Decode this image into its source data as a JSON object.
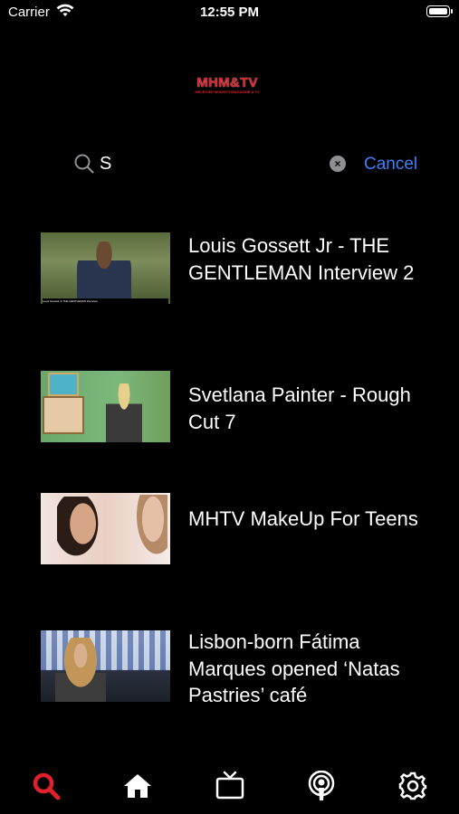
{
  "status_bar": {
    "carrier": "Carrier",
    "time": "12:55 PM"
  },
  "logo": {
    "title": "MHM&TV",
    "subtitle": "MELROSE HEIGHTS MAGAZINE & TV"
  },
  "search": {
    "query": "S",
    "cancel_label": "Cancel"
  },
  "results": [
    {
      "title": "Louis Gossett Jr - THE GENTLEMAN Interview 2",
      "thumb_caption": "Louis Gossett Jr THE GENTLEMAN Interview"
    },
    {
      "title": "Svetlana Painter - Rough Cut 7"
    },
    {
      "title": "MHTV MakeUp For Teens"
    },
    {
      "title": "Lisbon-born Fátima Marques opened ‘Natas Pastries’ café"
    }
  ],
  "tab_bar": {
    "active_color": "#e0202a",
    "inactive_color": "#ffffff",
    "tabs": [
      "search-icon",
      "home-icon",
      "tv-icon",
      "podcast-icon",
      "settings-icon"
    ]
  },
  "colors": {
    "accent": "#3d80f7",
    "brand": "#e0202a",
    "background": "#000000"
  }
}
